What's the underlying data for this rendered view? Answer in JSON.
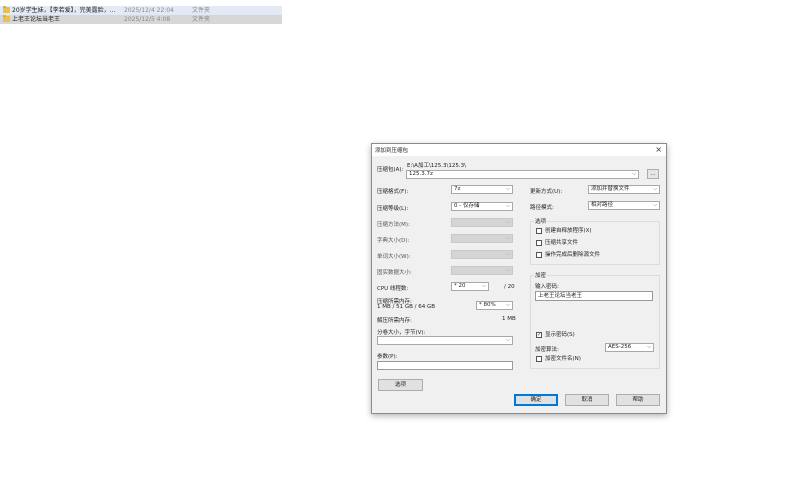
{
  "explorer": {
    "rows": [
      {
        "name": "20岁学生妹，【李若爱】，完美露脸，...",
        "date": "2025/12/4 22:04",
        "type": "文件夹"
      },
      {
        "name": "上老王论坛当老王",
        "date": "2025/12/5 4:08",
        "type": "文件夹"
      }
    ]
  },
  "dialog": {
    "title": "添加到压缩包",
    "archive_label": "压缩包(A):",
    "archive_path": "E:\\A加工\\125.3\\125.3\\",
    "archive_name": "125.3.7z",
    "browse_label": "...",
    "format_label": "压缩格式(F):",
    "format_value": "7z",
    "level_label": "压缩等级(L):",
    "level_value": "0 - 仅存储",
    "method_label": "压缩方法(M):",
    "dict_label": "字典大小(D):",
    "word_label": "单词大小(W):",
    "solid_label": "固实数据大小:",
    "cpu_label": "CPU 线程数:",
    "cpu_value": "* 20",
    "cpu_max": "/ 20",
    "mem_label": "压缩所需内存:",
    "mem_detail": "1 MB / 51 GB / 64 GB",
    "mem_value": "* 80%",
    "decomp_label": "解压所需内存:",
    "decomp_value": "1 MB",
    "split_label": "分卷大小，字节(V):",
    "params_label": "参数(P):",
    "options_button": "选项",
    "update_label": "更新方式(U):",
    "update_value": "添加并替换文件",
    "path_label": "路径模式:",
    "path_value": "相对路径",
    "options_group": "选项",
    "opt_sfx": "创建自释放程序(X)",
    "opt_shared": "压缩共享文件",
    "opt_delete": "操作完成后删除源文件",
    "encrypt_group": "加密",
    "password_label": "输入密码:",
    "password_value": "上老王论坛当老王",
    "show_password": "显示密码(S)",
    "show_password_check": "✓",
    "enc_method_label": "加密算法:",
    "enc_method_value": "AES-256",
    "enc_names": "加密文件名(N)",
    "ok": "确定",
    "cancel": "取消",
    "help": "帮助",
    "close_icon": "×",
    "chevron": "⌵"
  }
}
